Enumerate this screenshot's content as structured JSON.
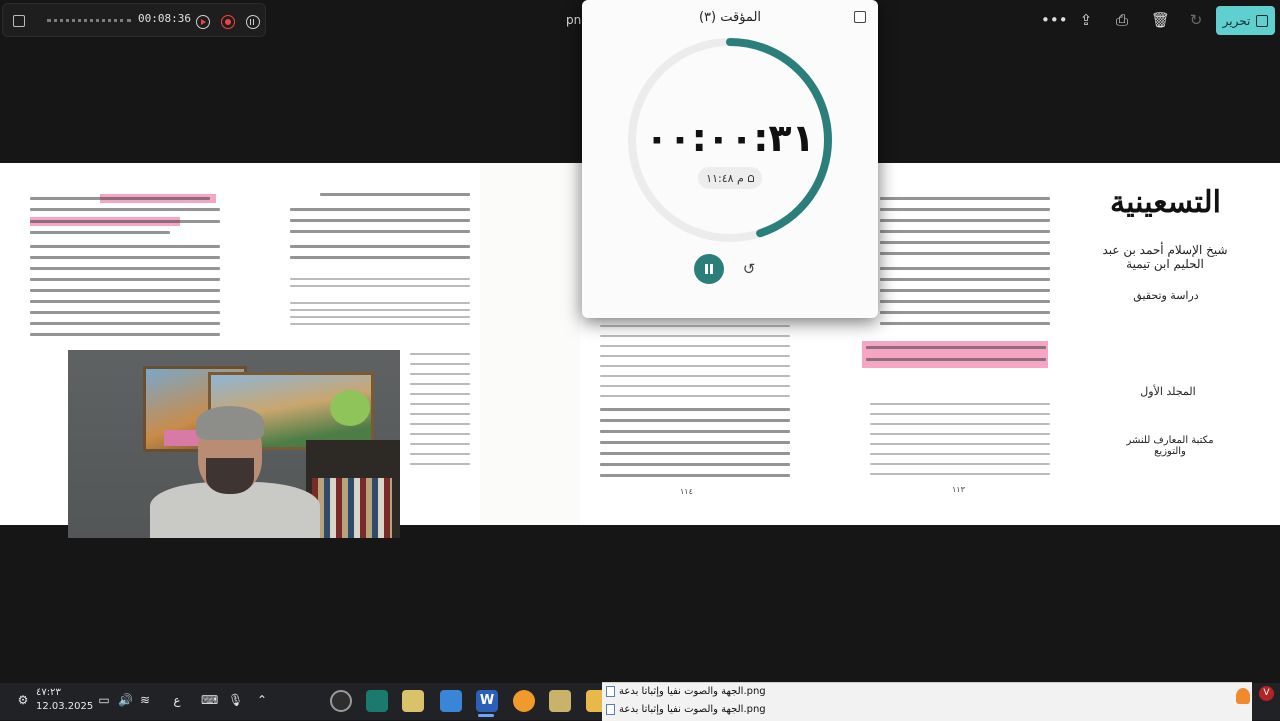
{
  "recorder": {
    "elapsed": "00:08:36"
  },
  "viewer": {
    "file_title": "png",
    "edit_label": "تحرير",
    "icons": [
      "more-icon",
      "share-icon",
      "print-icon",
      "delete-icon",
      "rotate-icon",
      "edit-icon"
    ]
  },
  "timer": {
    "title": "المؤقت (٣)",
    "display": "٠٠:٠٠:٣١",
    "alarm_time": "م ١١:٤٨",
    "progress_fraction": 0.45,
    "accent_color": "#2b7f7b"
  },
  "document": {
    "title_page": {
      "title": "التسعينية",
      "author": "شيخ الإسلام أحمد بن عبد الحليم ابن تيمية",
      "study": "دراسة وتحقيق",
      "volume": "المجلد الأول",
      "publisher": "مكتبة المعارف للنشر والتوزيع"
    },
    "page_numbers": [
      "١١٤",
      "١١٣"
    ],
    "highlight_color": "#f4a6c3"
  },
  "taskbar": {
    "time": "٤٧:٢٣",
    "date": "12.03.2025",
    "language": "ع",
    "apps": [
      "app-timer-icon",
      "app-store-icon",
      "app-pen-icon",
      "app-photo-icon",
      "app-word-icon",
      "app-search-icon",
      "app-pen2-icon",
      "app-folder-icon"
    ],
    "word_label": "W"
  },
  "file_list": {
    "items": [
      "الجهة والصوت نفيا وإثباتا بدعة.png",
      "الجهة والصوت نفيا وإثباتا بدعة.png"
    ]
  },
  "notification": {
    "badge": "V"
  }
}
